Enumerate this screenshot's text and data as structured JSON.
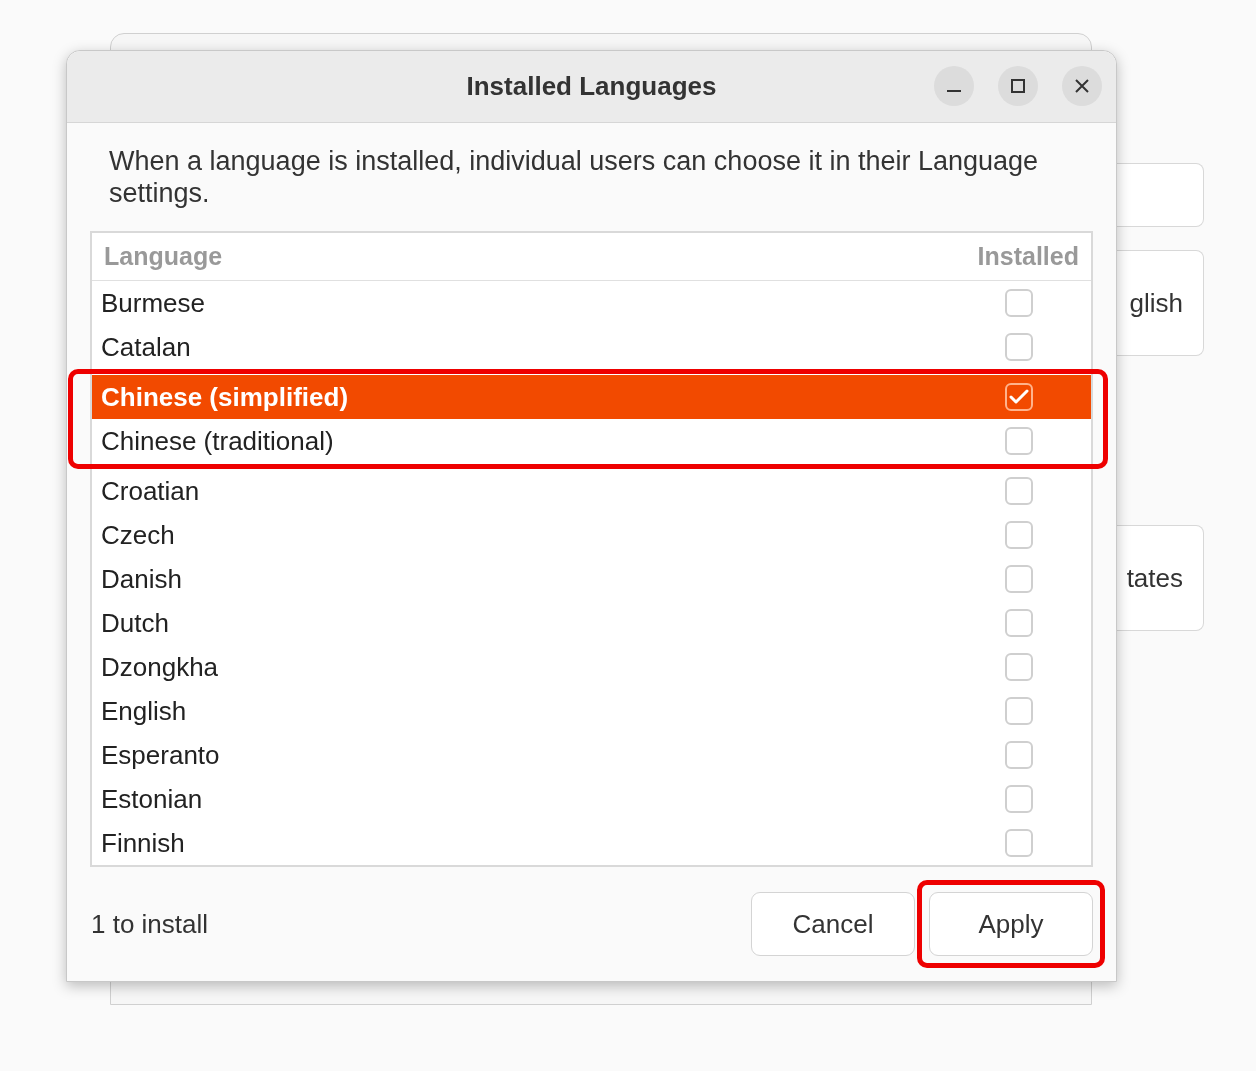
{
  "background_window": {
    "texts": [
      "glish",
      "tates"
    ]
  },
  "window": {
    "title": "Installed Languages"
  },
  "description": "When a language is installed, individual users can choose it in their Language settings.",
  "list": {
    "columns": [
      "Language",
      "Installed"
    ],
    "rows": [
      {
        "name": "Burmese",
        "installed": false,
        "selected": false,
        "highlighted": false
      },
      {
        "name": "Catalan",
        "installed": false,
        "selected": false,
        "highlighted": false
      },
      {
        "name": "Chinese (simplified)",
        "installed": true,
        "selected": true,
        "highlighted": true
      },
      {
        "name": "Chinese (traditional)",
        "installed": false,
        "selected": false,
        "highlighted": true
      },
      {
        "name": "Croatian",
        "installed": false,
        "selected": false,
        "highlighted": false
      },
      {
        "name": "Czech",
        "installed": false,
        "selected": false,
        "highlighted": false
      },
      {
        "name": "Danish",
        "installed": false,
        "selected": false,
        "highlighted": false
      },
      {
        "name": "Dutch",
        "installed": false,
        "selected": false,
        "highlighted": false
      },
      {
        "name": "Dzongkha",
        "installed": false,
        "selected": false,
        "highlighted": false
      },
      {
        "name": "English",
        "installed": false,
        "selected": false,
        "highlighted": false
      },
      {
        "name": "Esperanto",
        "installed": false,
        "selected": false,
        "highlighted": false
      },
      {
        "name": "Estonian",
        "installed": false,
        "selected": false,
        "highlighted": false
      },
      {
        "name": "Finnish",
        "installed": false,
        "selected": false,
        "highlighted": false
      }
    ]
  },
  "status": "1 to install",
  "buttons": [
    {
      "label": "Cancel",
      "highlighted": false
    },
    {
      "label": "Apply",
      "highlighted": true
    }
  ]
}
